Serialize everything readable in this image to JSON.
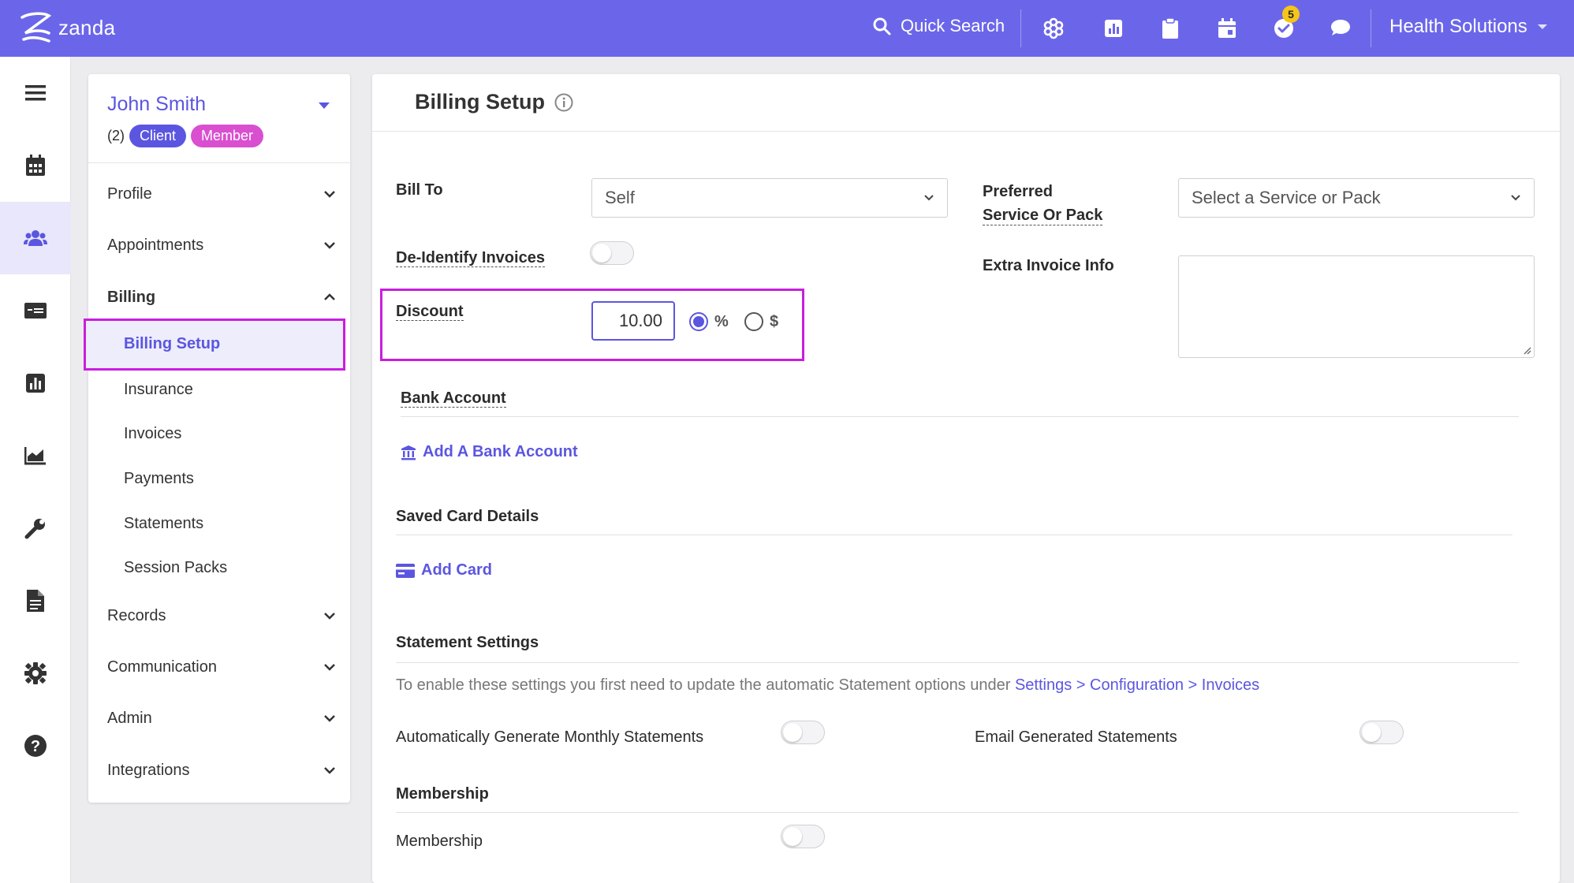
{
  "brand": {
    "name": "zanda",
    "accent": "#6b66e9",
    "highlight": "#c81ede"
  },
  "topbar": {
    "search_label": "Quick Search",
    "icons": [
      "search-icon",
      "modules-icon",
      "reports-icon",
      "clipboard-icon",
      "calendar-icon",
      "tasks-icon",
      "chat-icon"
    ],
    "tasks_badge": "5",
    "org_name": "Health Solutions"
  },
  "rail": {
    "items": [
      "menu-icon",
      "calendar-icon",
      "clients-icon",
      "billing-icon",
      "reports-icon",
      "analytics-icon",
      "tools-icon",
      "documents-icon",
      "settings-icon",
      "help-icon"
    ]
  },
  "client": {
    "name": "John Smith",
    "count": "(2)",
    "tags": [
      "Client",
      "Member"
    ]
  },
  "nav": {
    "profile": "Profile",
    "appointments": "Appointments",
    "billing": "Billing",
    "billing_sub": [
      "Billing Setup",
      "Insurance",
      "Invoices",
      "Payments",
      "Statements",
      "Session Packs"
    ],
    "records": "Records",
    "communication": "Communication",
    "admin": "Admin",
    "integrations": "Integrations"
  },
  "page": {
    "title": "Billing Setup",
    "bill_to_label": "Bill To",
    "bill_to_value": "Self",
    "preferred_label_1": "Preferred",
    "preferred_label_2": "Service Or Pack",
    "preferred_placeholder": "Select a Service or Pack",
    "deidentify_label": "De-Identify Invoices",
    "extra_info_label": "Extra Invoice Info",
    "discount_label": "Discount",
    "discount_value": "10.00",
    "discount_percent": "%",
    "discount_dollar": "$",
    "bank_section": "Bank Account",
    "add_bank": "Add A Bank Account",
    "card_section": "Saved Card Details",
    "add_card": "Add Card",
    "statement_section": "Statement Settings",
    "statement_hint": "To enable these settings you first need to update the automatic Statement options under ",
    "statement_hint_link": "Settings > Configuration > Invoices",
    "auto_statements": "Automatically Generate Monthly Statements",
    "email_statements": "Email Generated Statements",
    "membership_section": "Membership",
    "membership_label": "Membership"
  }
}
